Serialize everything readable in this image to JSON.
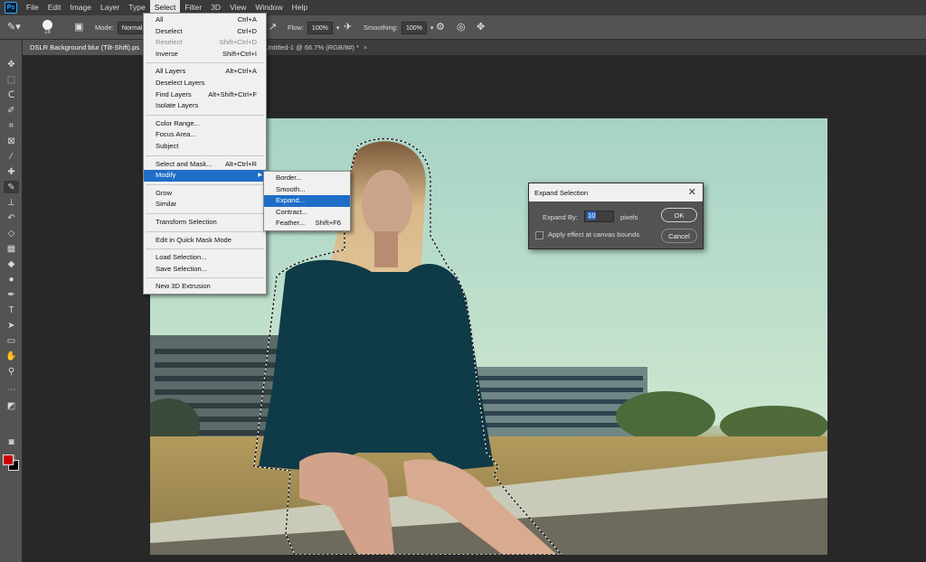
{
  "app": {
    "logo": "Ps",
    "menus": [
      "File",
      "Edit",
      "Image",
      "Layer",
      "Type",
      "Select",
      "Filter",
      "3D",
      "View",
      "Window",
      "Help"
    ],
    "active_menu": "Select"
  },
  "options": {
    "brush_size": "18",
    "mode_label": "Mode:",
    "mode_value": "Normal",
    "flow_label": "Flow:",
    "flow_value": "100%",
    "smoothing_label": "Smoothing:",
    "smoothing_value": "100%"
  },
  "tabs": [
    {
      "label": "DSLR Background blur (Tilt-Shift).ps",
      "active": true
    },
    {
      "label": "Untitled-1 @ 66.7% (RGB/8#) *",
      "close": "×",
      "active": false
    }
  ],
  "select_menu": {
    "items": [
      {
        "label": "All",
        "shortcut": "Ctrl+A"
      },
      {
        "label": "Deselect",
        "shortcut": "Ctrl+D"
      },
      {
        "label": "Reselect",
        "shortcut": "Shift+Ctrl+D",
        "disabled": true
      },
      {
        "label": "Inverse",
        "shortcut": "Shift+Ctrl+I"
      },
      {
        "sep": true
      },
      {
        "label": "All Layers",
        "shortcut": "Alt+Ctrl+A"
      },
      {
        "label": "Deselect Layers",
        "shortcut": ""
      },
      {
        "label": "Find Layers",
        "shortcut": "Alt+Shift+Ctrl+F"
      },
      {
        "label": "Isolate Layers",
        "shortcut": ""
      },
      {
        "sep": true
      },
      {
        "label": "Color Range...",
        "shortcut": ""
      },
      {
        "label": "Focus Area...",
        "shortcut": ""
      },
      {
        "label": "Subject",
        "shortcut": ""
      },
      {
        "sep": true
      },
      {
        "label": "Select and Mask...",
        "shortcut": "Alt+Ctrl+R"
      },
      {
        "label": "Modify",
        "shortcut": "",
        "submenu": true,
        "selected": true
      },
      {
        "sep": true
      },
      {
        "label": "Grow",
        "shortcut": ""
      },
      {
        "label": "Similar",
        "shortcut": ""
      },
      {
        "sep": true
      },
      {
        "label": "Transform Selection",
        "shortcut": ""
      },
      {
        "sep": true
      },
      {
        "label": "Edit in Quick Mask Mode",
        "shortcut": ""
      },
      {
        "sep": true
      },
      {
        "label": "Load Selection...",
        "shortcut": ""
      },
      {
        "label": "Save Selection...",
        "shortcut": ""
      },
      {
        "sep": true
      },
      {
        "label": "New 3D Extrusion",
        "shortcut": ""
      }
    ]
  },
  "modify_menu": {
    "items": [
      {
        "label": "Border...",
        "shortcut": ""
      },
      {
        "label": "Smooth...",
        "shortcut": ""
      },
      {
        "label": "Expand...",
        "shortcut": "",
        "selected": true
      },
      {
        "label": "Contract...",
        "shortcut": ""
      },
      {
        "label": "Feather...",
        "shortcut": "Shift+F6"
      }
    ]
  },
  "dialog": {
    "title": "Expand Selection",
    "close": "✕",
    "expand_label": "Expand By:",
    "expand_value": "10",
    "unit": "pixels",
    "checkbox_label": "Apply effect at canvas bounds",
    "ok_label": "OK",
    "cancel_label": "Cancel"
  },
  "colors": {
    "foreground": "#cc0000",
    "background": "#000000",
    "menu_highlight": "#1e6ec8"
  },
  "tools": [
    "move-icon",
    "marquee-icon",
    "lasso-icon",
    "quick-select-icon",
    "crop-icon",
    "frame-icon",
    "eyedropper-icon",
    "healing-icon",
    "brush-icon",
    "stamp-icon",
    "history-brush-icon",
    "eraser-icon",
    "gradient-icon",
    "blur-icon",
    "dodge-icon",
    "pen-icon",
    "type-icon",
    "path-select-icon",
    "rectangle-icon",
    "hand-icon",
    "zoom-icon",
    "more-icon"
  ]
}
